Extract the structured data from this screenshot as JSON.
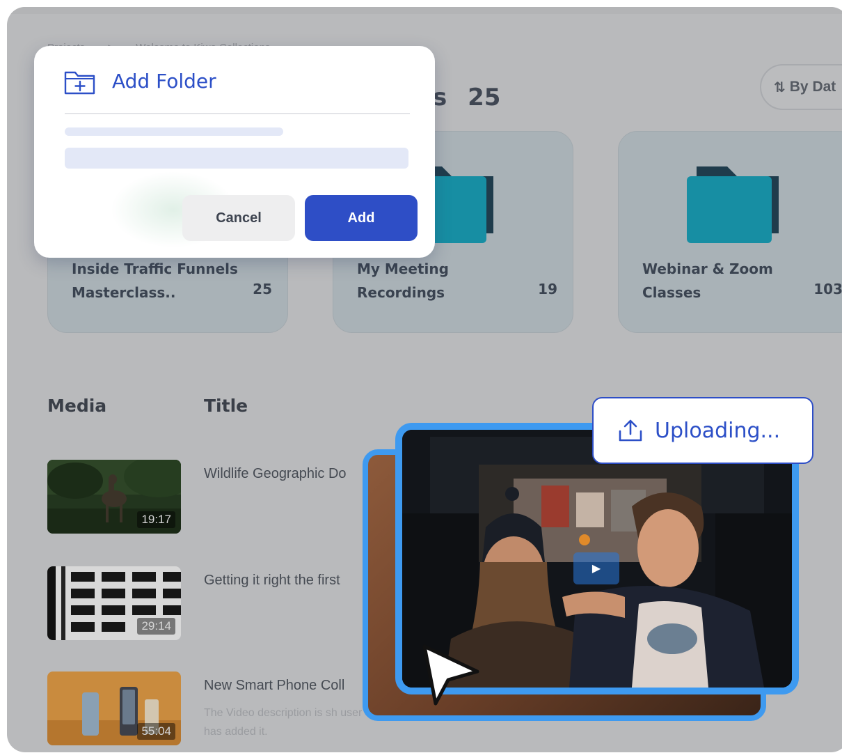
{
  "breadcrumb": {
    "root": "Projects",
    "separator": ">",
    "current": "Welcome to Kiwa Collections"
  },
  "folders_header": {
    "title_tail": "s",
    "count": "25"
  },
  "sort_button": {
    "label": "By Dat",
    "icon": "sort-arrows-icon"
  },
  "folders": [
    {
      "name": "Inside Traffic Funnels Masterclass..",
      "count": "25"
    },
    {
      "name": "My Meeting Recordings",
      "count": "19"
    },
    {
      "name": "Webinar & Zoom Classes",
      "count": "103"
    }
  ],
  "media_table": {
    "columns": [
      "Media",
      "Title"
    ],
    "rows": [
      {
        "title": "Wildlife Geographic Do",
        "duration": "19:17",
        "description": ""
      },
      {
        "title": "Getting it right the first",
        "duration": "29:14",
        "description": ""
      },
      {
        "title": "New Smart Phone Coll",
        "duration": "55:04",
        "description": "The Video description is sh user has added it."
      }
    ]
  },
  "dialog": {
    "title": "Add Folder",
    "icon": "folder-plus-icon",
    "cancel_label": "Cancel",
    "add_label": "Add"
  },
  "upload": {
    "status": "Uploading...",
    "icon": "upload-tray-icon"
  },
  "colors": {
    "accent_blue": "#2e4ec6",
    "upload_border": "#3e9af0",
    "folder_teal": "#178ea3",
    "folder_dark": "#1f3c4c",
    "overlay": "#b9babc"
  }
}
